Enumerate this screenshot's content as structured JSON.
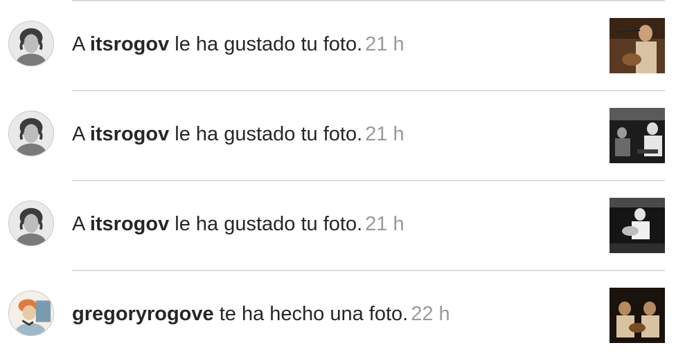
{
  "notifications": [
    {
      "prefix": "A ",
      "user": "itsrogov",
      "message": " le ha gustado tu foto.",
      "time": "21 h",
      "avatar_icon": "user-avatar-bw",
      "thumb_icon": "photo-thumbnail"
    },
    {
      "prefix": "A ",
      "user": "itsrogov",
      "message": " le ha gustado tu foto.",
      "time": "21 h",
      "avatar_icon": "user-avatar-bw",
      "thumb_icon": "photo-thumbnail"
    },
    {
      "prefix": "A ",
      "user": "itsrogov",
      "message": " le ha gustado tu foto.",
      "time": "21 h",
      "avatar_icon": "user-avatar-bw",
      "thumb_icon": "photo-thumbnail"
    },
    {
      "prefix": "",
      "user": "gregoryrogove",
      "message": " te ha hecho una foto.",
      "time": "22 h",
      "avatar_icon": "user-avatar-color",
      "thumb_icon": "photo-thumbnail"
    }
  ],
  "colors": {
    "text": "#262626",
    "muted": "#999999",
    "separator": "#dbdbdb"
  }
}
